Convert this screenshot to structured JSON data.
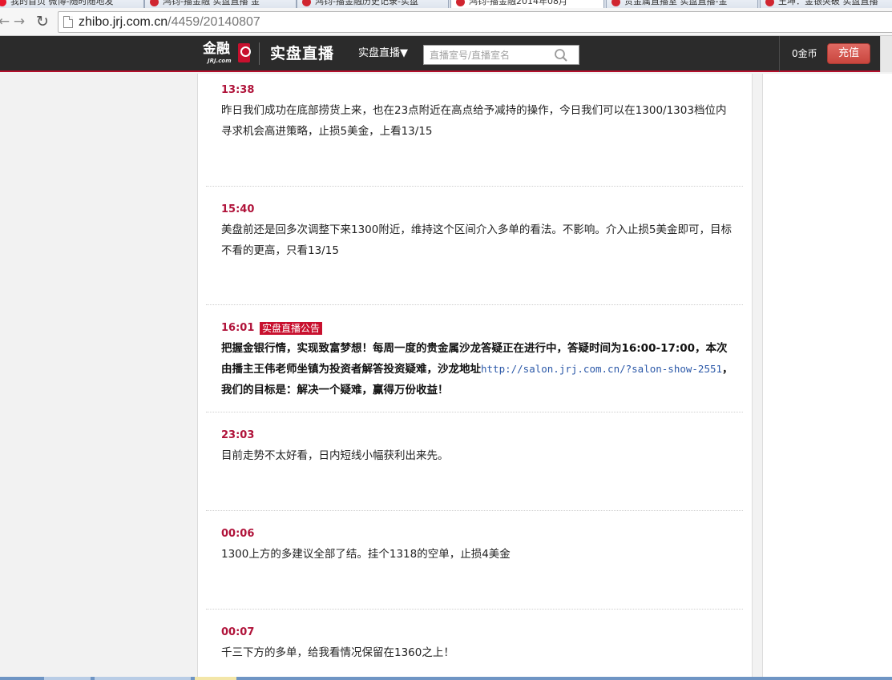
{
  "browser": {
    "tabs": [
      {
        "label": "我的首页 微博-随时随地发"
      },
      {
        "label": "鸿钧-播金融 实盘直播 金"
      },
      {
        "label": "鸿钧-播金融历史记录-实盘"
      },
      {
        "label": "鸿钧-播金融2014年08月"
      },
      {
        "label": "贵金属直播室 实盘直播-金"
      },
      {
        "label": "王坤：金银突破 实盘直播"
      }
    ],
    "url_host": "zhibo.jrj.com.cn",
    "url_path": "/4459/20140807"
  },
  "header": {
    "logo_cn": "金融",
    "logo_en": "JRJ.com",
    "logo_live": "实盘直播",
    "menu_label": "实盘直播▼",
    "search_placeholder": "直播室号/直播室名",
    "coins": "0金币",
    "recharge_label": "充值"
  },
  "posts": [
    {
      "time": "13:38",
      "text": "昨日我们成功在底部捞货上来，也在23点附近在高点给予减持的操作，今日我们可以在1300/1303档位内寻求机会高进策略，止损5美金，上看13/15"
    },
    {
      "time": "15:40",
      "text": "美盘前还是回多次调整下来1300附近，维持这个区间介入多单的看法。不影响。介入止损5美金即可，目标不看的更高，只看13/15"
    },
    {
      "time": "16:01",
      "tag": "实盘直播公告",
      "text_before": "把握金银行情，实现致富梦想！每周一度的贵金属沙龙答疑正在进行中，答疑时间为16:00-17:00，本次由播主王伟老师坐镇为投资者解答投资疑难，沙龙地址",
      "link": "http://salon.jrj.com.cn/?salon-show-2551",
      "text_after": "，我们的目标是：解决一个疑难，赢得万份收益！"
    },
    {
      "time": "23:03",
      "text": "目前走势不太好看，日内短线小幅获利出来先。"
    },
    {
      "time": "00:06",
      "text": "1300上方的多建议全部了结。挂个1318的空单，止损4美金"
    },
    {
      "time": "00:07",
      "text": "千三下方的多单，给我看情况保留在1360之上！"
    }
  ]
}
